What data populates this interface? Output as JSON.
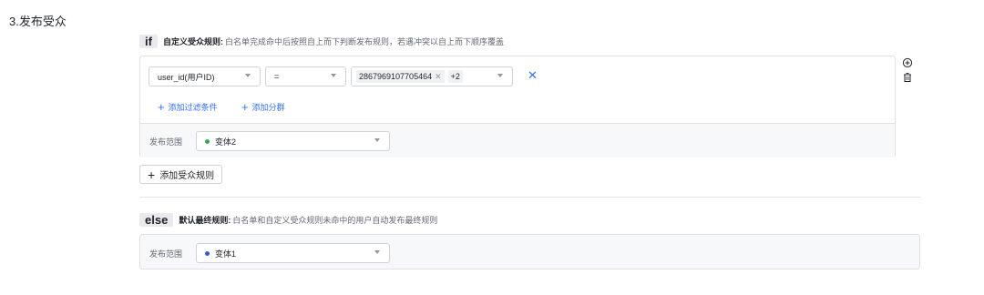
{
  "section": {
    "title": "3.发布受众"
  },
  "if_rule": {
    "tag": "if",
    "name": "自定义受众规则:",
    "description": "白名单完成命中后按照自上而下判断发布规则，若遇冲突以自上而下顺序覆盖"
  },
  "condition": {
    "field": "user_id(用户ID)",
    "operator": "=",
    "values": [
      "2867969107705464"
    ],
    "more_count": "+2",
    "remove_icon": "close-icon"
  },
  "actions": {
    "add_filter": "添加过滤条件",
    "add_group": "添加分群",
    "add_audience_rule": "添加受众规则"
  },
  "if_release": {
    "label": "发布范围",
    "variant": "变体2",
    "dot_color": "#34a853"
  },
  "else_rule": {
    "tag": "else",
    "name": "默认最终规则:",
    "description": "白名单和自定义受众规则未命中的用户自动发布最终规则"
  },
  "else_release": {
    "label": "发布范围",
    "variant": "变体1",
    "dot_color": "#3b5bcc"
  },
  "side_icons": [
    "plus-circle-icon",
    "trash-icon"
  ],
  "colors": {
    "accent": "#3370ff",
    "border": "#dee0e3",
    "band": "#f7f8fa"
  }
}
